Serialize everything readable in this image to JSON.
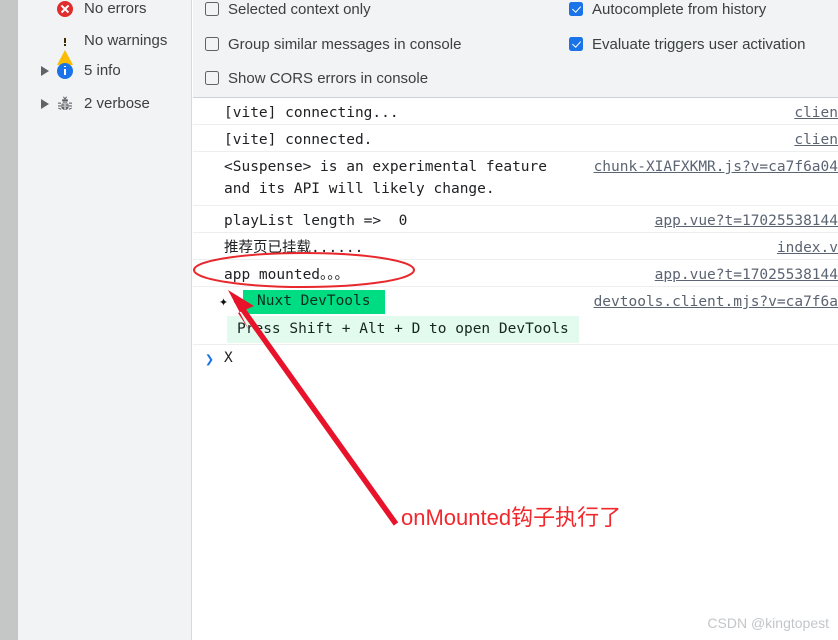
{
  "sidebar": {
    "items": [
      {
        "label": "No errors",
        "icon": "error-circle-icon",
        "expandable": false
      },
      {
        "label": "No warnings",
        "icon": "warning-triangle-icon",
        "expandable": false
      },
      {
        "label": "5 info",
        "icon": "info-circle-icon",
        "expandable": true
      },
      {
        "label": "2 verbose",
        "icon": "bug-icon",
        "expandable": true
      }
    ]
  },
  "settings": {
    "checkboxes": [
      {
        "label": "Selected context only",
        "checked": false
      },
      {
        "label": "Group similar messages in console",
        "checked": false
      },
      {
        "label": "Show CORS errors in console",
        "checked": false
      },
      {
        "label": "Autocomplete from history",
        "checked": true
      },
      {
        "label": "Evaluate triggers user activation",
        "checked": true
      }
    ]
  },
  "console": {
    "messages": [
      {
        "text": "[vite] connecting...",
        "source": "clien"
      },
      {
        "text": "[vite] connected.",
        "source": "clien"
      },
      {
        "text": "<Suspense> is an experimental feature\nand its API will likely change.",
        "source": "chunk-XIAFXKMR.js?v=ca7f6a04"
      },
      {
        "text": "playList length =>  0",
        "source": "app.vue?t=17025538144"
      },
      {
        "text": "推荐页已挂载......",
        "source": "index.v"
      },
      {
        "text": "app mounted。。。",
        "source": "app.vue?t=17025538144"
      }
    ],
    "nuxt": {
      "star_glyph": "✦",
      "badge": "Nuxt DevTools",
      "tip": "Press Shift + Alt + D to open DevTools",
      "source": "devtools.client.mjs?v=ca7f6a"
    },
    "prompt": {
      "chevron": "❯",
      "value": "X"
    }
  },
  "annotation": {
    "text": "onMounted钩子执行了",
    "color": "#f2282c"
  },
  "watermark": "CSDN @kingtopest"
}
